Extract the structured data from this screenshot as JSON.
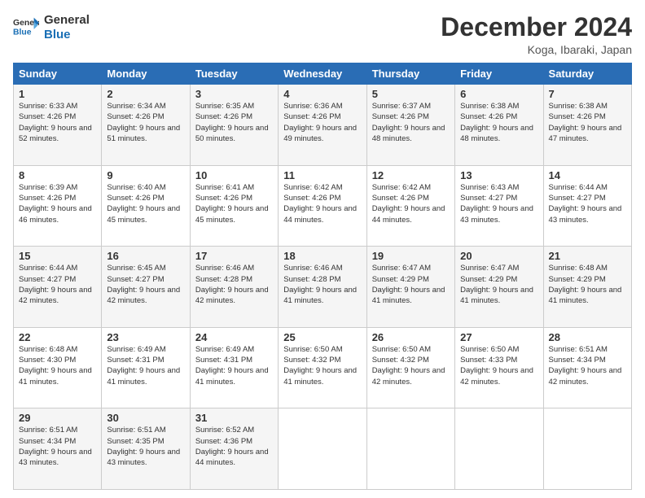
{
  "logo": {
    "line1": "General",
    "line2": "Blue"
  },
  "title": "December 2024",
  "location": "Koga, Ibaraki, Japan",
  "weekdays": [
    "Sunday",
    "Monday",
    "Tuesday",
    "Wednesday",
    "Thursday",
    "Friday",
    "Saturday"
  ],
  "weeks": [
    [
      {
        "day": "1",
        "sunrise": "6:33 AM",
        "sunset": "4:26 PM",
        "daylight": "9 hours and 52 minutes."
      },
      {
        "day": "2",
        "sunrise": "6:34 AM",
        "sunset": "4:26 PM",
        "daylight": "9 hours and 51 minutes."
      },
      {
        "day": "3",
        "sunrise": "6:35 AM",
        "sunset": "4:26 PM",
        "daylight": "9 hours and 50 minutes."
      },
      {
        "day": "4",
        "sunrise": "6:36 AM",
        "sunset": "4:26 PM",
        "daylight": "9 hours and 49 minutes."
      },
      {
        "day": "5",
        "sunrise": "6:37 AM",
        "sunset": "4:26 PM",
        "daylight": "9 hours and 48 minutes."
      },
      {
        "day": "6",
        "sunrise": "6:38 AM",
        "sunset": "4:26 PM",
        "daylight": "9 hours and 48 minutes."
      },
      {
        "day": "7",
        "sunrise": "6:38 AM",
        "sunset": "4:26 PM",
        "daylight": "9 hours and 47 minutes."
      }
    ],
    [
      {
        "day": "8",
        "sunrise": "6:39 AM",
        "sunset": "4:26 PM",
        "daylight": "9 hours and 46 minutes."
      },
      {
        "day": "9",
        "sunrise": "6:40 AM",
        "sunset": "4:26 PM",
        "daylight": "9 hours and 45 minutes."
      },
      {
        "day": "10",
        "sunrise": "6:41 AM",
        "sunset": "4:26 PM",
        "daylight": "9 hours and 45 minutes."
      },
      {
        "day": "11",
        "sunrise": "6:42 AM",
        "sunset": "4:26 PM",
        "daylight": "9 hours and 44 minutes."
      },
      {
        "day": "12",
        "sunrise": "6:42 AM",
        "sunset": "4:26 PM",
        "daylight": "9 hours and 44 minutes."
      },
      {
        "day": "13",
        "sunrise": "6:43 AM",
        "sunset": "4:27 PM",
        "daylight": "9 hours and 43 minutes."
      },
      {
        "day": "14",
        "sunrise": "6:44 AM",
        "sunset": "4:27 PM",
        "daylight": "9 hours and 43 minutes."
      }
    ],
    [
      {
        "day": "15",
        "sunrise": "6:44 AM",
        "sunset": "4:27 PM",
        "daylight": "9 hours and 42 minutes."
      },
      {
        "day": "16",
        "sunrise": "6:45 AM",
        "sunset": "4:27 PM",
        "daylight": "9 hours and 42 minutes."
      },
      {
        "day": "17",
        "sunrise": "6:46 AM",
        "sunset": "4:28 PM",
        "daylight": "9 hours and 42 minutes."
      },
      {
        "day": "18",
        "sunrise": "6:46 AM",
        "sunset": "4:28 PM",
        "daylight": "9 hours and 41 minutes."
      },
      {
        "day": "19",
        "sunrise": "6:47 AM",
        "sunset": "4:29 PM",
        "daylight": "9 hours and 41 minutes."
      },
      {
        "day": "20",
        "sunrise": "6:47 AM",
        "sunset": "4:29 PM",
        "daylight": "9 hours and 41 minutes."
      },
      {
        "day": "21",
        "sunrise": "6:48 AM",
        "sunset": "4:29 PM",
        "daylight": "9 hours and 41 minutes."
      }
    ],
    [
      {
        "day": "22",
        "sunrise": "6:48 AM",
        "sunset": "4:30 PM",
        "daylight": "9 hours and 41 minutes."
      },
      {
        "day": "23",
        "sunrise": "6:49 AM",
        "sunset": "4:31 PM",
        "daylight": "9 hours and 41 minutes."
      },
      {
        "day": "24",
        "sunrise": "6:49 AM",
        "sunset": "4:31 PM",
        "daylight": "9 hours and 41 minutes."
      },
      {
        "day": "25",
        "sunrise": "6:50 AM",
        "sunset": "4:32 PM",
        "daylight": "9 hours and 41 minutes."
      },
      {
        "day": "26",
        "sunrise": "6:50 AM",
        "sunset": "4:32 PM",
        "daylight": "9 hours and 42 minutes."
      },
      {
        "day": "27",
        "sunrise": "6:50 AM",
        "sunset": "4:33 PM",
        "daylight": "9 hours and 42 minutes."
      },
      {
        "day": "28",
        "sunrise": "6:51 AM",
        "sunset": "4:34 PM",
        "daylight": "9 hours and 42 minutes."
      }
    ],
    [
      {
        "day": "29",
        "sunrise": "6:51 AM",
        "sunset": "4:34 PM",
        "daylight": "9 hours and 43 minutes."
      },
      {
        "day": "30",
        "sunrise": "6:51 AM",
        "sunset": "4:35 PM",
        "daylight": "9 hours and 43 minutes."
      },
      {
        "day": "31",
        "sunrise": "6:52 AM",
        "sunset": "4:36 PM",
        "daylight": "9 hours and 44 minutes."
      },
      null,
      null,
      null,
      null
    ]
  ]
}
